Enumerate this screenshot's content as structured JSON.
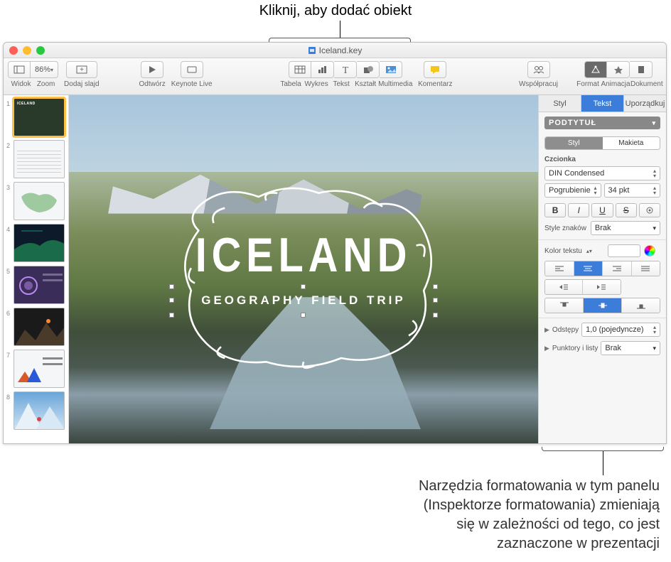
{
  "annotations": {
    "top": "Kliknij, aby dodać obiekt",
    "bottom_l1": "Narzędzia formatowania w tym panelu",
    "bottom_l2": "(Inspektorze formatowania) zmieniają",
    "bottom_l3": "się w zależności od tego, co jest",
    "bottom_l4": "zaznaczone w prezentacji"
  },
  "window": {
    "title": "Iceland.key"
  },
  "toolbar": {
    "view": "Widok",
    "zoom": "Zoom",
    "zoom_value": "86%",
    "add_slide": "Dodaj slajd",
    "play": "Odtwórz",
    "keynote_live": "Keynote Live",
    "table": "Tabela",
    "chart": "Wykres",
    "text": "Tekst",
    "shape": "Kształt",
    "media": "Multimedia",
    "comment": "Komentarz",
    "collaborate": "Współpracuj",
    "format": "Format",
    "animate": "Animacja",
    "document": "Dokument"
  },
  "slides": {
    "s1": "ICELAND",
    "s2": "",
    "s3": "",
    "s4": "",
    "s5": "",
    "s6": "",
    "s7": "",
    "s8": ""
  },
  "canvas": {
    "title": "ICELAND",
    "subtitle": "GEOGRAPHY FIELD TRIP"
  },
  "inspector": {
    "tabs": {
      "style": "Styl",
      "text": "Tekst",
      "arrange": "Uporządkuj"
    },
    "para_style": "PODTYTUŁ",
    "subtabs": {
      "style": "Styl",
      "layout": "Makieta"
    },
    "font_section": "Czcionka",
    "font_name": "DIN Condensed",
    "font_weight": "Pogrubienie",
    "font_size": "34 pkt",
    "bold": "B",
    "italic": "I",
    "underline": "U",
    "strike": "S",
    "char_styles_label": "Style znaków",
    "char_styles_value": "Brak",
    "text_color_label": "Kolor tekstu",
    "spacing_label": "Odstępy",
    "spacing_value": "1,0 (pojedyncze)",
    "bullets_label": "Punktory i listy",
    "bullets_value": "Brak"
  }
}
